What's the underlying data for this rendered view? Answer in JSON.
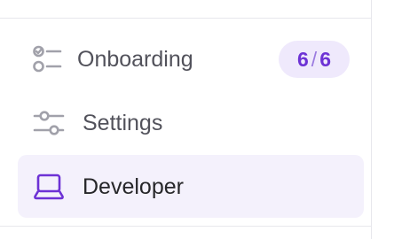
{
  "nav": {
    "items": [
      {
        "label": "Onboarding",
        "icon": "checklist-icon",
        "badge": {
          "done": "6",
          "separator": "/",
          "total": "6"
        },
        "active": false
      },
      {
        "label": "Settings",
        "icon": "sliders-icon",
        "active": false
      },
      {
        "label": "Developer",
        "icon": "laptop-icon",
        "active": true
      }
    ]
  },
  "colors": {
    "accent": "#6d32d5",
    "active_background": "#f4f1fc",
    "badge_background": "#efe9fc",
    "icon_gray": "#a1a1aa",
    "text": "#52525b",
    "divider": "#e7e7ec"
  }
}
